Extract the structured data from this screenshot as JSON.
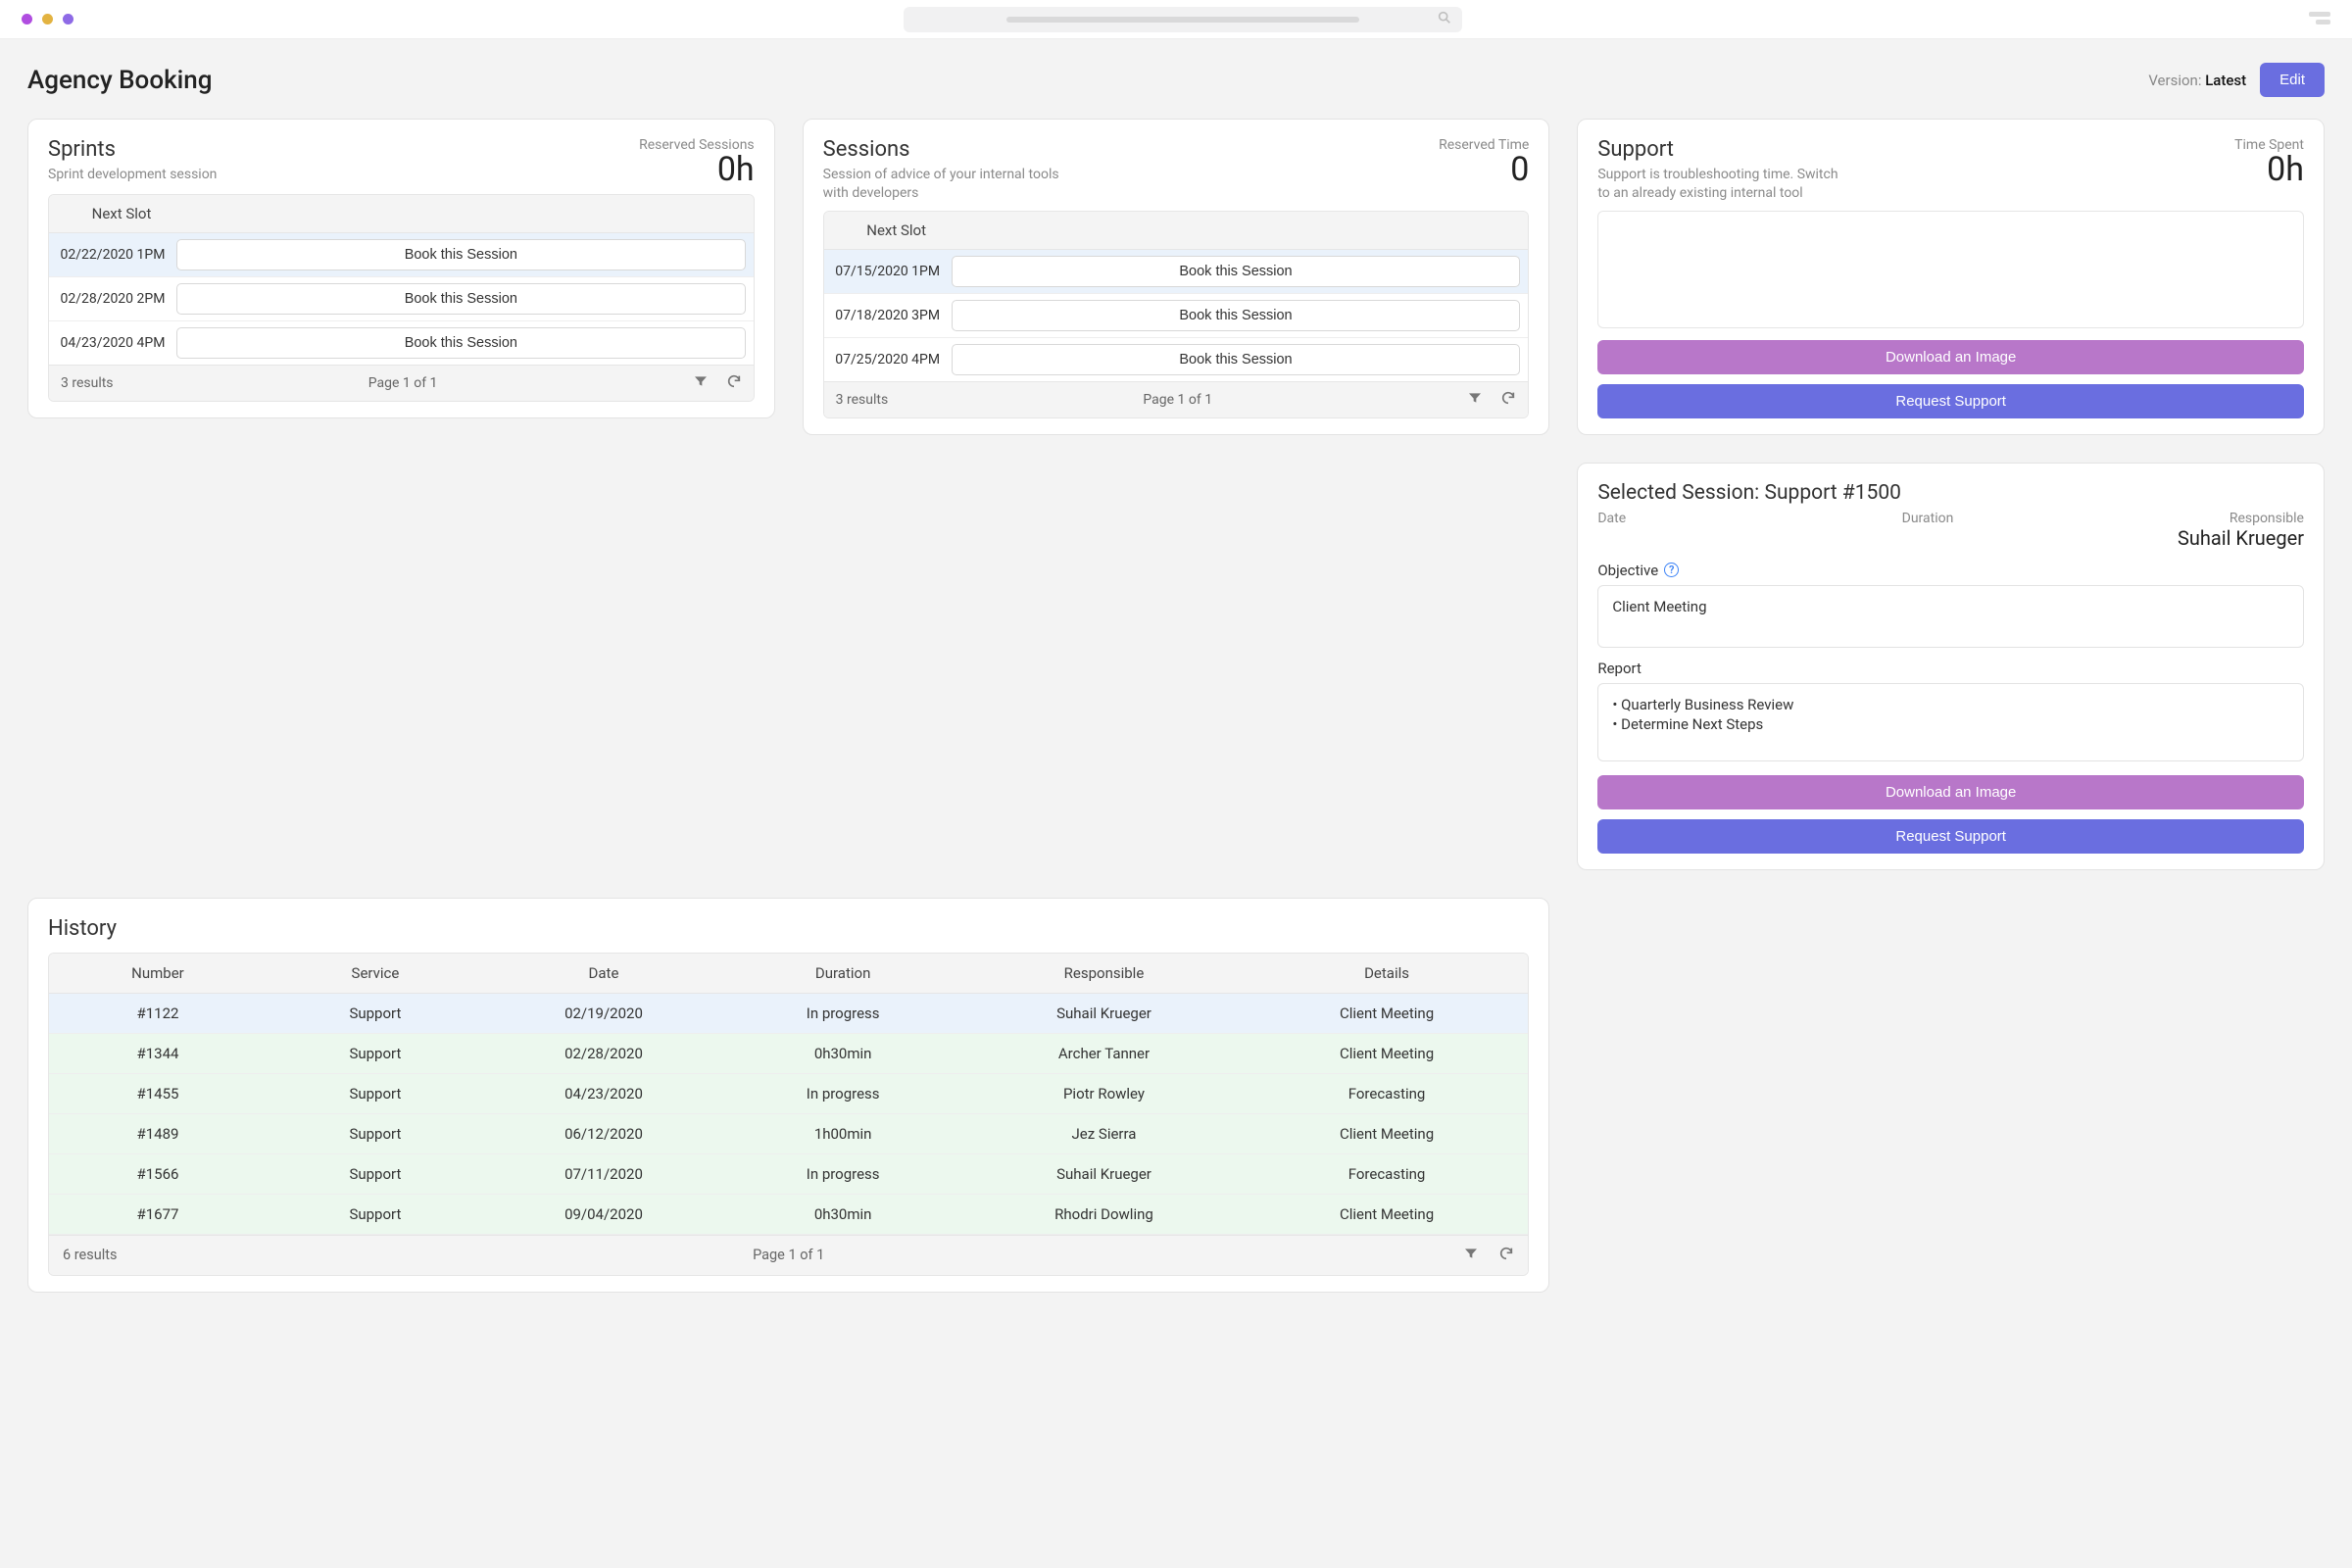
{
  "page": {
    "title": "Agency Booking",
    "version_label": "Version:",
    "version_value": "Latest",
    "edit_label": "Edit"
  },
  "sprints": {
    "title": "Sprints",
    "subtitle": "Sprint development session",
    "metric_label": "Reserved Sessions",
    "metric_value": "0h",
    "next_slot_label": "Next Slot",
    "book_label": "Book this Session",
    "slots": [
      {
        "date": "02/22/2020 1PM",
        "selected": true
      },
      {
        "date": "02/28/2020 2PM",
        "selected": false
      },
      {
        "date": "04/23/2020 4PM",
        "selected": false
      }
    ],
    "results_text": "3 results",
    "page_text": "Page 1 of 1"
  },
  "sessions": {
    "title": "Sessions",
    "subtitle": "Session of advice of your internal tools with developers",
    "metric_label": "Reserved Time",
    "metric_value": "0",
    "next_slot_label": "Next Slot",
    "book_label": "Book this Session",
    "slots": [
      {
        "date": "07/15/2020 1PM",
        "selected": true
      },
      {
        "date": "07/18/2020 3PM",
        "selected": false
      },
      {
        "date": "07/25/2020 4PM",
        "selected": false
      }
    ],
    "results_text": "3 results",
    "page_text": "Page 1 of 1"
  },
  "support": {
    "title": "Support",
    "subtitle": "Support is troubleshooting time. Switch to an already existing internal tool",
    "metric_label": "Time Spent",
    "metric_value": "0h",
    "download_label": "Download an Image",
    "request_label": "Request Support"
  },
  "history": {
    "title": "History",
    "columns": {
      "number": "Number",
      "service": "Service",
      "date": "Date",
      "duration": "Duration",
      "responsible": "Responsible",
      "details": "Details"
    },
    "rows": [
      {
        "number": "#1122",
        "service": "Support",
        "date": "02/19/2020",
        "duration": "In progress",
        "responsible": "Suhail Krueger",
        "details": "Client Meeting",
        "tone": "blue"
      },
      {
        "number": "#1344",
        "service": "Support",
        "date": "02/28/2020",
        "duration": "0h30min",
        "responsible": "Archer Tanner",
        "details": "Client Meeting",
        "tone": "green"
      },
      {
        "number": "#1455",
        "service": "Support",
        "date": "04/23/2020",
        "duration": "In progress",
        "responsible": "Piotr Rowley",
        "details": "Forecasting",
        "tone": "green"
      },
      {
        "number": "#1489",
        "service": "Support",
        "date": "06/12/2020",
        "duration": "1h00min",
        "responsible": "Jez Sierra",
        "details": "Client Meeting",
        "tone": "green"
      },
      {
        "number": "#1566",
        "service": "Support",
        "date": "07/11/2020",
        "duration": "In progress",
        "responsible": "Suhail Krueger",
        "details": "Forecasting",
        "tone": "green"
      },
      {
        "number": "#1677",
        "service": "Support",
        "date": "09/04/2020",
        "duration": "0h30min",
        "responsible": "Rhodri Dowling",
        "details": "Client Meeting",
        "tone": "green"
      }
    ],
    "results_text": "6 results",
    "page_text": "Page 1 of 1"
  },
  "selected": {
    "title": "Selected Session: Support #1500",
    "date_label": "Date",
    "date_value": "",
    "duration_label": "Duration",
    "duration_value": "",
    "responsible_label": "Responsible",
    "responsible_value": "Suhail Krueger",
    "objective_label": "Objective",
    "objective_value": "Client Meeting",
    "report_label": "Report",
    "report_items": [
      "• Quarterly Business Review",
      "• Determine Next Steps"
    ],
    "download_label": "Download an Image",
    "request_label": "Request Support"
  }
}
